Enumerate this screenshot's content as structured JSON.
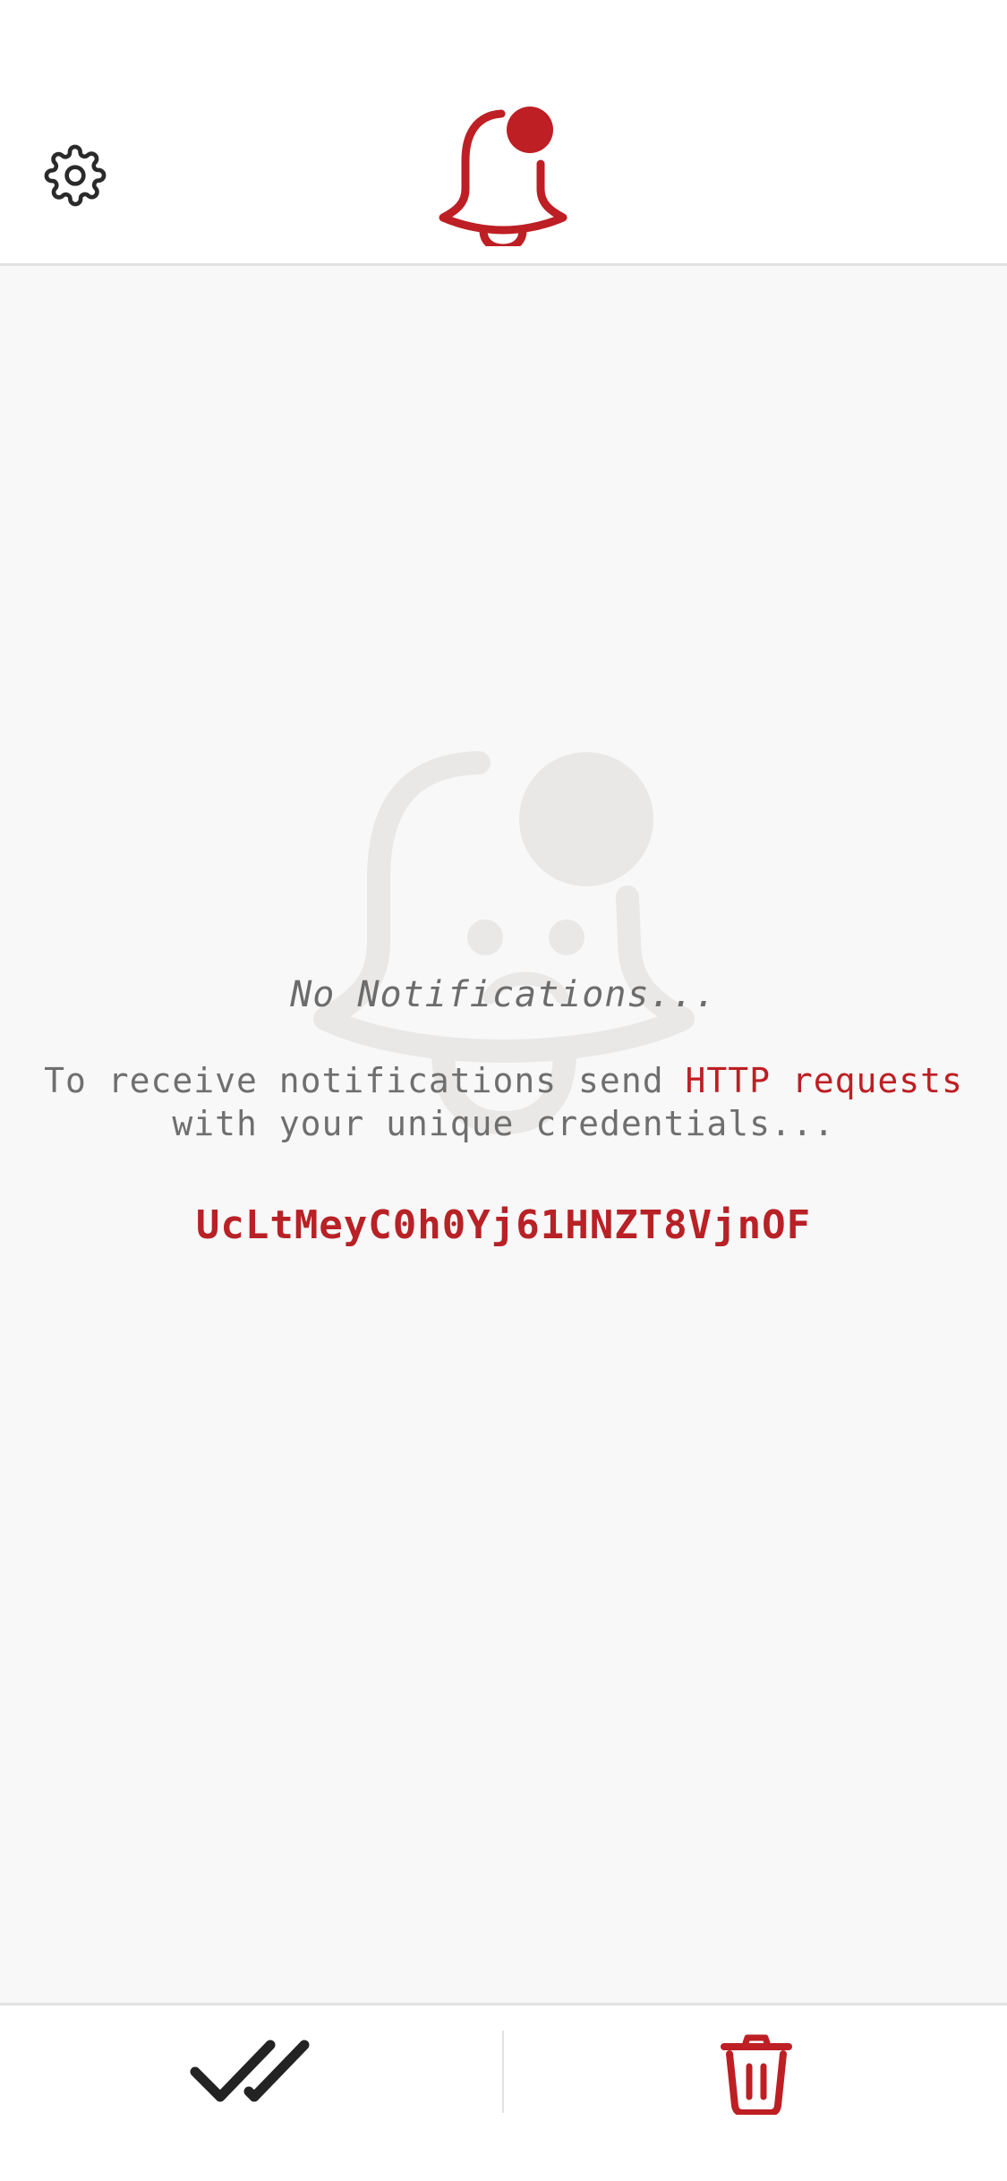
{
  "header": {
    "settings_icon": "gear-icon",
    "logo_icon": "bell-with-badge-icon",
    "accent_color": "#bd1f24"
  },
  "empty_state": {
    "illustration_icon": "sad-bell-icon",
    "title": "No Notifications...",
    "description_before": "To receive notifications send ",
    "description_link": "HTTP requests",
    "description_after": " with your unique credentials...",
    "credential": "UcLtMeyC0h0Yj61HNZT8VjnOF"
  },
  "bottom_bar": {
    "mark_all_read_icon": "double-check-icon",
    "delete_all_icon": "trash-icon"
  }
}
